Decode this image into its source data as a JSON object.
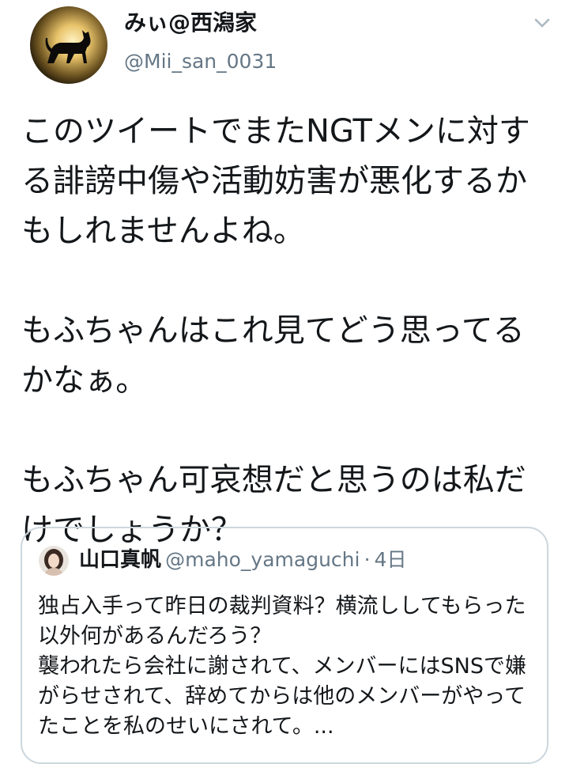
{
  "tweet": {
    "author": {
      "display_name": "みぃ@西潟家",
      "handle": "@Mii_san_0031",
      "avatar_icon": "cat-silhouette-avatar-icon"
    },
    "menu_icon": "chevron-down-icon",
    "text": "このツイートでまたNGTメンに対する誹謗中傷や活動妨害が悪化するかもしれませんよね。\n\nもふちゃんはこれ見てどう思ってるかなぁ。\n\nもふちゃん可哀想だと思うのは私だけでしょうか？"
  },
  "quoted_tweet": {
    "author": {
      "display_name": "山口真帆",
      "handle": "@maho_yamaguchi",
      "avatar_icon": "profile-photo-avatar-icon"
    },
    "separator": "·",
    "time": "4日",
    "text": "独占入手って昨日の裁判資料？横流ししてもらった以外何があるんだろう？\n襲われたら会社に謝されて、メンバーにはSNSで嫌がらせされて、辞めてからは他のメンバーがやってたことを私のせいにされて。..."
  },
  "colors": {
    "text_primary": "#14171a",
    "text_secondary": "#657786",
    "border": "#ccd6dd",
    "background": "#ffffff"
  }
}
